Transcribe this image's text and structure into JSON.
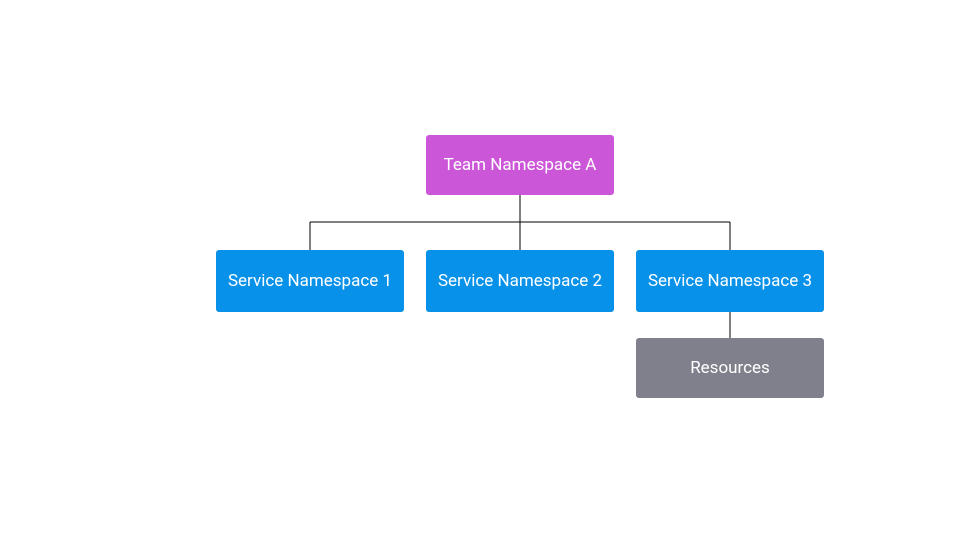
{
  "diagram": {
    "root": {
      "label": "Team Namespace A",
      "color": "#cc56d8"
    },
    "children": [
      {
        "label": "Service Namespace 1",
        "color": "#0891e8"
      },
      {
        "label": "Service Namespace 2",
        "color": "#0891e8"
      },
      {
        "label": "Service Namespace 3",
        "color": "#0891e8"
      }
    ],
    "grandchild": {
      "label": "Resources",
      "color": "#80808c",
      "parent_index": 2
    }
  }
}
